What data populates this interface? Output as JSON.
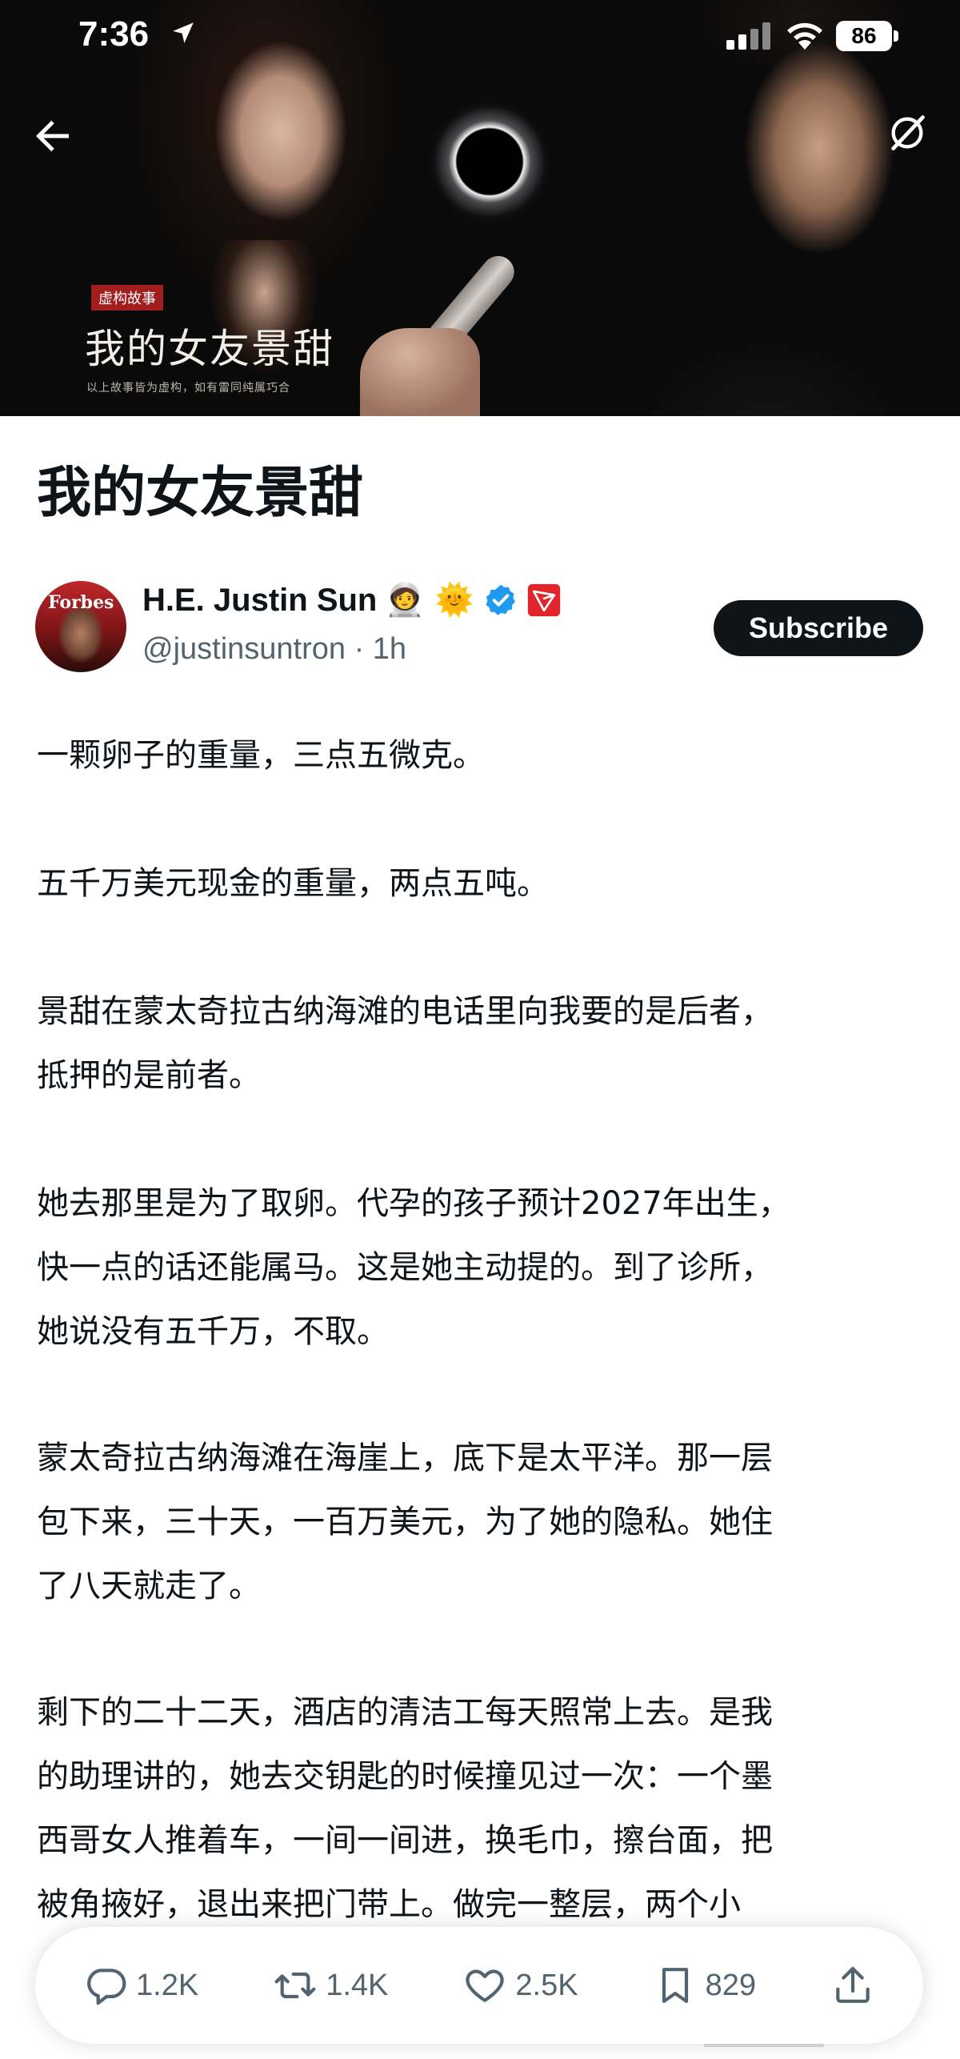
{
  "status_bar": {
    "time": "7:36",
    "battery": "86"
  },
  "hero": {
    "tag": "虚构故事",
    "title": "我的女友景甜",
    "disclaimer": "以上故事皆为虚构，如有雷同纯属巧合"
  },
  "nav": {
    "back_icon": "arrow-left-icon",
    "grok_icon": "grok-icon"
  },
  "article": {
    "title": "我的女友景甜",
    "author": {
      "name": "H.E. Justin Sun",
      "handle_time": "@justinsuntron · 1h",
      "avatar_text": "Forbes",
      "badges": [
        "🧑‍🚀",
        "🌞"
      ],
      "verified_color": "#1d9bf0",
      "tron_color": "#e0252b"
    },
    "subscribe_label": "Subscribe",
    "paragraphs": [
      [
        "一颗卵子的重量，三点五微克。"
      ],
      [
        "五千万美元现金的重量，两点五吨。"
      ],
      [
        "景甜在蒙太奇拉古纳海滩的电话里向我要的是后者，",
        "抵押的是前者。"
      ],
      [
        "她去那里是为了取卵。代孕的孩子预计2027年出生，",
        "快一点的话还能属马。这是她主动提的。到了诊所，",
        "她说没有五千万，不取。"
      ],
      [
        "蒙太奇拉古纳海滩在海崖上，底下是太平洋。那一层",
        "包下来，三十天，一百万美元，为了她的隐私。她住",
        "了八天就走了。"
      ],
      [
        "剩下的二十二天，酒店的清洁工每天照常上去。是我",
        "的助理讲的，她去交钥匙的时候撞见过一次：一个墨",
        "西哥女人推着车，一间一间进，换毛巾，擦台面，把",
        "被角掖好，退出来把门带上。做完一整层，两个小"
      ]
    ]
  },
  "actions": {
    "reply_count": "1.2K",
    "repost_count": "1.4K",
    "like_count": "2.5K",
    "bookmark_count": "829"
  }
}
